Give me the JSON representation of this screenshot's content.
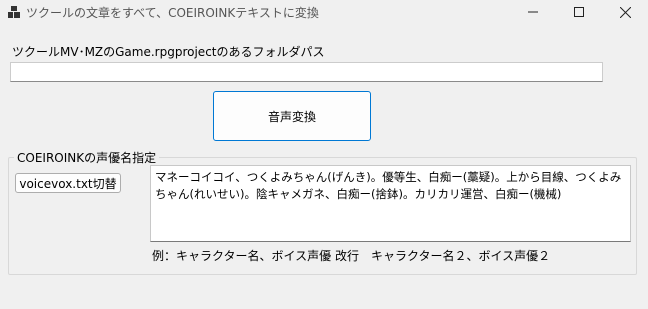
{
  "window": {
    "title": "ツクールの文章をすべて、COEIROINKテキストに変換",
    "controls": [
      "minimize",
      "maximize",
      "close"
    ]
  },
  "folder": {
    "label": "ツクールMV･MZのGame.rpgprojectのあるフォルダパス",
    "value": ""
  },
  "actions": {
    "convert_label": "音声変換"
  },
  "voice_group": {
    "title": "COEIROINKの声優名指定",
    "switch_button_label": "voicevox.txt切替",
    "voice_text": "マネーコイコイ、つくよみちゃん(げんき)。優等生、白痴ー(藁疑)。上から目線、つくよみちゃん(れいせい)。陰キャメガネ、白痴ー(捨鉢)。カリカリ運営、白痴ー(機械)",
    "example": "例：キャラクター名、ボイス声優 改行　キャラクター名２、ボイス声優２"
  },
  "colors": {
    "accent": "#0078d4",
    "background": "#f0f0f0"
  }
}
